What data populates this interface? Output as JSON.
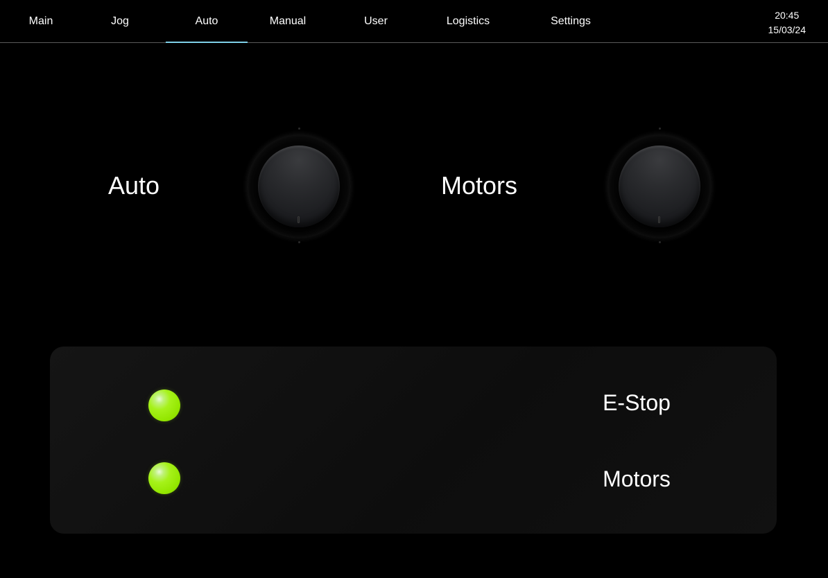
{
  "nav": {
    "tabs": [
      {
        "label": "Main",
        "active": false
      },
      {
        "label": "Jog",
        "active": false
      },
      {
        "label": "Auto",
        "active": true
      },
      {
        "label": "Manual",
        "active": false
      },
      {
        "label": "User",
        "active": false
      },
      {
        "label": "Logistics",
        "active": false
      },
      {
        "label": "Settings",
        "active": false
      }
    ],
    "clock": {
      "time": "20:45",
      "date": "15/03/24"
    },
    "accent_color": "#7fd0e8"
  },
  "switches": [
    {
      "label": "Auto",
      "state": "off"
    },
    {
      "label": "Motors",
      "state": "off"
    }
  ],
  "status_panel": {
    "indicators": [
      {
        "label": "E-Stop",
        "color": "#9ef000",
        "lit": true
      },
      {
        "label": "Motors",
        "color": "#9ef000",
        "lit": true
      }
    ]
  }
}
